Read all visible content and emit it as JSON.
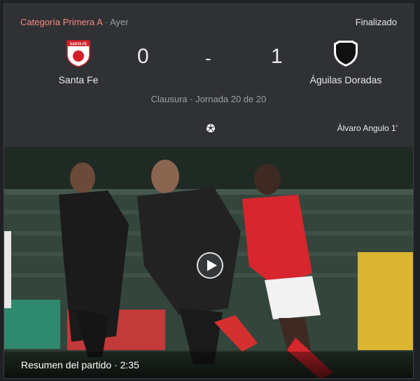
{
  "header": {
    "league": "Categoría Primera A",
    "separator": "·",
    "when": "Ayer",
    "status": "Finalizado"
  },
  "home": {
    "name": "Santa Fe",
    "score": "0",
    "crest_text": "SANTA FE",
    "crest_icon": "santa-fe-crest-icon"
  },
  "away": {
    "name": "Águilas Doradas",
    "score": "1",
    "crest_icon": "aguilas-doradas-crest-icon"
  },
  "score_separator": "-",
  "round": "Clausura · Jornada 20 de 20",
  "goal": {
    "icon": "soccer-ball-icon",
    "scorer": "Álvaro Angulo 1'"
  },
  "video": {
    "caption": "Resumen del partido · 2:35",
    "play_icon": "play-icon"
  },
  "colors": {
    "card_bg": "#303134",
    "league_accent": "#f28b82",
    "secondary_text": "#9aa0a6",
    "santa_fe_red": "#d41f2b"
  }
}
